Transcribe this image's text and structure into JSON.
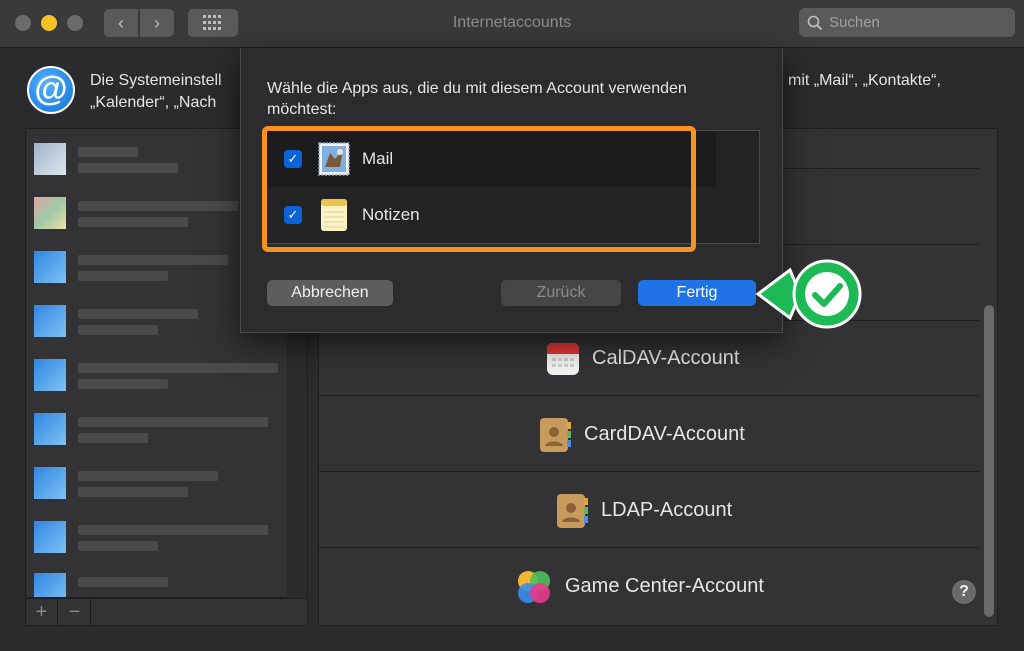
{
  "window": {
    "title": "Internetaccounts",
    "search_placeholder": "Suchen"
  },
  "header": {
    "line1_left": "Die Systemeinstell",
    "line2_left": "„Kalender“, „Nach",
    "line1_right": "mit „Mail“, „Kontakte“,"
  },
  "sheet": {
    "title": "Wähle die Apps aus, die du mit diesem Account verwenden möchtest:",
    "apps": [
      {
        "label": "Mail",
        "checked": true,
        "icon": "mail-stamp-icon"
      },
      {
        "label": "Notizen",
        "checked": true,
        "icon": "notes-icon"
      }
    ],
    "cancel_label": "Abbrechen",
    "back_label": "Zurück",
    "done_label": "Fertig"
  },
  "services": [
    {
      "label": "CalDAV-Account",
      "icon": "calendar-icon"
    },
    {
      "label": "CardDAV-Account",
      "icon": "contacts-icon"
    },
    {
      "label": "LDAP-Account",
      "icon": "contacts-icon"
    },
    {
      "label": "Game Center-Account",
      "icon": "game-center-icon"
    }
  ],
  "list_controls": {
    "add": "+",
    "remove": "−"
  },
  "help_label": "?",
  "colors": {
    "accent_blue": "#1f73e6",
    "highlight_orange": "#f7931e",
    "callout_green": "#1db954"
  }
}
